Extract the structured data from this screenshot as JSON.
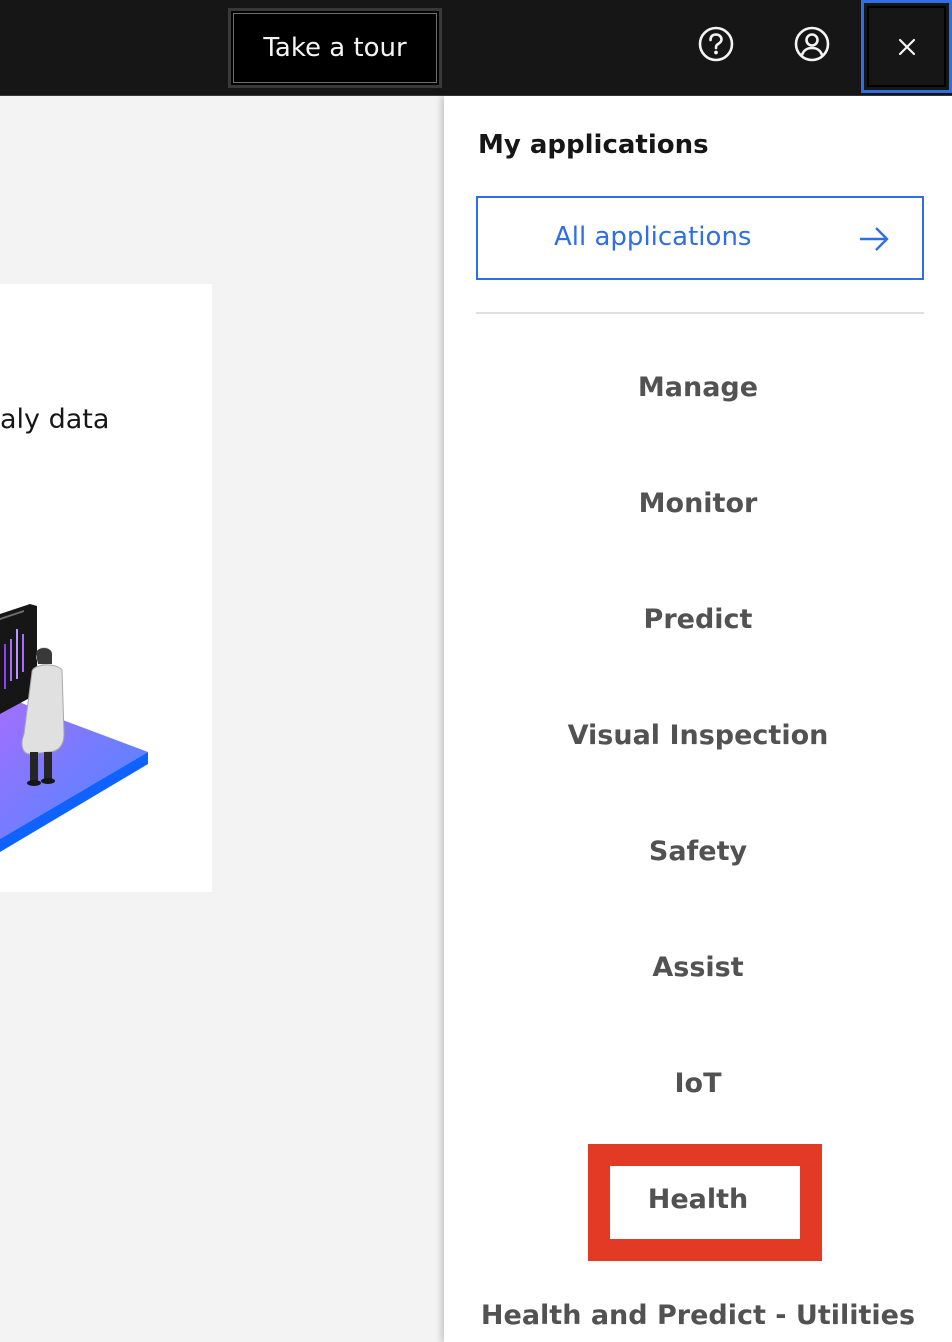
{
  "header": {
    "tour_button": "Take a tour",
    "icons": [
      "help-icon",
      "user-avatar-icon",
      "close-icon"
    ]
  },
  "background": {
    "card_text": "aly data"
  },
  "panel": {
    "title": "My applications",
    "all_apps_label": "All applications",
    "apps": [
      {
        "label": "Manage"
      },
      {
        "label": "Monitor"
      },
      {
        "label": "Predict"
      },
      {
        "label": "Visual Inspection"
      },
      {
        "label": "Safety"
      },
      {
        "label": "Assist"
      },
      {
        "label": "IoT"
      },
      {
        "label": "Health"
      },
      {
        "label": "Health and Predict - Utilities"
      }
    ],
    "highlighted_app": "Health"
  },
  "colors": {
    "accent_blue": "#2f6fe6",
    "highlight_red": "#e33a25",
    "header_bg": "#161616"
  }
}
